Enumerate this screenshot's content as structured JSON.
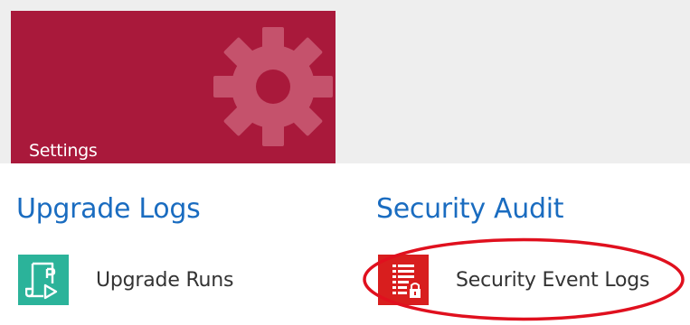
{
  "settings_tile": {
    "label": "Settings",
    "background_color": "#a9193b",
    "icon": "gear-icon"
  },
  "groups": [
    {
      "title": "Upgrade Logs",
      "items": [
        {
          "label": "Upgrade Runs",
          "icon": "scroll-play-icon",
          "icon_color": "#2bb39a"
        }
      ]
    },
    {
      "title": "Security Audit",
      "items": [
        {
          "label": "Security Event Logs",
          "icon": "document-lock-icon",
          "icon_color": "#d81e1e"
        }
      ]
    }
  ],
  "highlight": {
    "target": "Security Event Logs",
    "color": "#e0101e"
  }
}
